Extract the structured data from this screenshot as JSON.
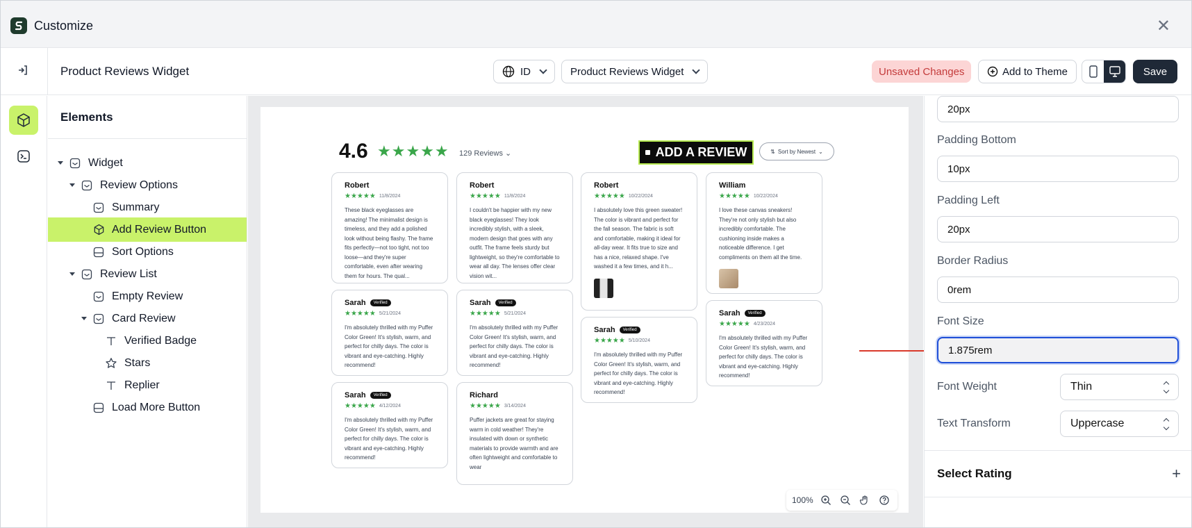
{
  "window": {
    "title": "Customize"
  },
  "topbar": {
    "page_title": "Product Reviews Widget",
    "language": "ID",
    "widget_select": "Product Reviews Widget",
    "unsaved": "Unsaved Changes",
    "add_to_theme": "Add to Theme",
    "save": "Save"
  },
  "elements": {
    "heading": "Elements",
    "items": [
      {
        "label": "Widget"
      },
      {
        "label": "Review Options"
      },
      {
        "label": "Summary"
      },
      {
        "label": "Add Review Button"
      },
      {
        "label": "Sort Options"
      },
      {
        "label": "Review List"
      },
      {
        "label": "Empty Review"
      },
      {
        "label": "Card Review"
      },
      {
        "label": "Verified Badge"
      },
      {
        "label": "Stars"
      },
      {
        "label": "Replier"
      },
      {
        "label": "Load More Button"
      }
    ]
  },
  "preview": {
    "rating": "4.6",
    "reviews_count": "129 Reviews",
    "add_review": "ADD A REVIEW",
    "sort": "Sort by Newest",
    "stars": "★★★★★",
    "verified": "Verified",
    "cards": [
      {
        "name": "Robert",
        "date": "11/8/2024",
        "body": "These black eyeglasses are amazing! The minimalist design is timeless, and they add a polished look without being flashy. The frame fits perfectly—not too tight, not too loose—and they're super comfortable, even after wearing them for hours. The qual..."
      },
      {
        "name": "Robert",
        "date": "11/8/2024",
        "body": "I couldn't be happier with my new black eyeglasses! They look incredibly stylish, with a sleek, modern design that goes with any outfit. The frame feels sturdy but lightweight, so they're comfortable to wear all day. The lenses offer clear vision wit..."
      },
      {
        "name": "Robert",
        "date": "10/22/2024",
        "body": "I absolutely love this green sweater! The color is vibrant and perfect for the fall season. The fabric is soft and comfortable, making it ideal for all-day wear. It fits true to size and has a nice, relaxed shape. I've washed it a few times, and it h..."
      },
      {
        "name": "William",
        "date": "10/22/2024",
        "body": "I love these canvas sneakers! They're not only stylish but also incredibly comfortable. The cushioning inside makes a noticeable difference. I get compliments on them all the time."
      },
      {
        "name": "Sarah",
        "date": "5/21/2024",
        "body": "I'm absolutely thrilled with my Puffer Color Green! It's stylish, warm, and perfect for chilly days. The color is vibrant and eye-catching. Highly recommend!"
      },
      {
        "name": "Sarah",
        "date": "5/21/2024",
        "body": "I'm absolutely thrilled with my Puffer Color Green! It's stylish, warm, and perfect for chilly days. The color is vibrant and eye-catching. Highly recommend!"
      },
      {
        "name": "Sarah",
        "date": "5/10/2024",
        "body": "I'm absolutely thrilled with my Puffer Color Green! It's stylish, warm, and perfect for chilly days. The color is vibrant and eye-catching. Highly recommend!"
      },
      {
        "name": "Sarah",
        "date": "4/23/2024",
        "body": "I'm absolutely thrilled with my Puffer Color Green! It's stylish, warm, and perfect for chilly days. The color is vibrant and eye-catching. Highly recommend!"
      },
      {
        "name": "Sarah",
        "date": "4/12/2024",
        "body": "I'm absolutely thrilled with my Puffer Color Green! It's stylish, warm, and perfect for chilly days. The color is vibrant and eye-catching. Highly recommend!"
      },
      {
        "name": "Richard",
        "date": "3/14/2024",
        "body": "Puffer jackets are great for staying warm in cold weather! They're insulated with down or synthetic materials to provide warmth and are often lightweight and comfortable to wear"
      }
    ],
    "zoom": "100%"
  },
  "properties": {
    "padding_right_value": "20px",
    "padding_bottom_label": "Padding Bottom",
    "padding_bottom_value": "10px",
    "padding_left_label": "Padding Left",
    "padding_left_value": "20px",
    "border_radius_label": "Border Radius",
    "border_radius_value": "0rem",
    "font_size_label": "Font Size",
    "font_size_value": "1.875rem",
    "font_weight_label": "Font Weight",
    "font_weight_value": "Thin",
    "text_transform_label": "Text Transform",
    "text_transform_value": "Uppercase",
    "select_rating": "Select Rating"
  },
  "colors": {
    "accent": "#c9f26a",
    "star": "#3aa64a",
    "unsaved_bg": "#fcd5d5",
    "unsaved_text": "#c43b3b",
    "focus": "#1f4fd8"
  }
}
